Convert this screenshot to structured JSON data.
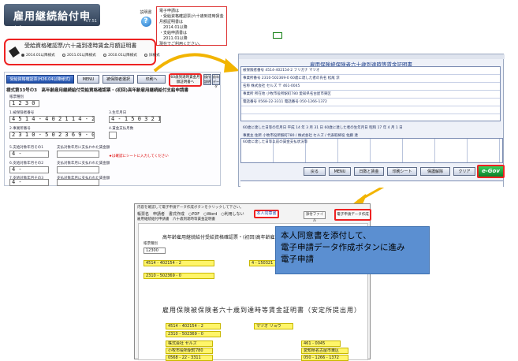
{
  "app": {
    "title": "雇用継続給付申請",
    "version": "V7.51"
  },
  "help": {
    "label": "説明書",
    "icon": "question-icon"
  },
  "note": {
    "lines": [
      "電子申請は",
      "・受給資格確認票/六十歳到達時賃金月額証明書は",
      "　2014.01以降",
      "・支給申請書は",
      "　2011.01以降",
      "現在でご利用ください。"
    ]
  },
  "selector": {
    "title": "受給資格確認票/六十歳到達時賃金月額証明書",
    "options": [
      {
        "label": "2014.01以降様式",
        "selected": true
      },
      {
        "label": "2011.01以降様式",
        "selected": false
      },
      {
        "label": "2010.01以降様式",
        "selected": false
      },
      {
        "label": "旧様式",
        "selected": false
      }
    ]
  },
  "left_form": {
    "toolbar": {
      "primary": "受給資格確認票(H26.04以降様式)",
      "menu": "MENU",
      "other": "被保険者選択",
      "print": "印刷へ",
      "hilite": "60歳到達時賃金月額証明書へ",
      "b1": "操作説明",
      "b2": "前年データ",
      "b3": "前年データ"
    },
    "heading": "様式第33号の3　高年齢雇用継続給付受給資格確認票・(初回)高年齢雇用継続給付支給申請書",
    "fields": {
      "code_label": "帳票種別",
      "code_value": "1 2 3 0 0",
      "insured_no_label": "1.被保険者番号",
      "insured_no": "4 5 1 4 - 4 0 2 1 1 4 - 2",
      "office_no_label": "2.事業所番号",
      "office_no": "2 3 1 0 - 5 0 2 3 6 9 - 0",
      "birth_label": "3.生年月日",
      "birth_value": "4 - 1 5 0 3 2 1",
      "month_label": "4.賃金支払月数",
      "f5": "5.支給対象年月その1",
      "f6": "6.支給対象年月その2",
      "f7": "7.支給対象年月その3",
      "pay1": "支払対象年月に支払われた賃金額",
      "pay2": "支払対象年月に支払われた賃金額",
      "pay3": "支払対象年月に支払われた賃金額",
      "red_note": "★は確認にシートに入力してください",
      "prefix1": "4 -",
      "prefix2": "4 -",
      "prefix3": "4 -"
    }
  },
  "right_form": {
    "title": "雇用保険被保険者六十歳到達時等賃金証明書",
    "row1": "被保険者番号 4514-402154-2   フリガナ マツオ",
    "row2": "事業所番号 2310-502369-0   60歳に達した者の氏名 松尾 涼",
    "row3": "名称 株式会社 セルズ   〒 461-0045",
    "row4": "事業所 所在地 小牧市役所駅町780   愛知県名古屋市東区",
    "row5": "電話番号 0568-22-3311   電話番号 050-1266-1372",
    "row6": "60歳に達した日等の年月日 平成 14 年 3 月 31 日   60歳に達した者の生年月日 昭和 17 年 4 月 1 日",
    "row7": "事業主 住所 小牧市役所駅町780 / 株式会社 セルズ / 代表取締役 佐藤 達",
    "buttons": {
      "back": "戻る",
      "menu": "MENU",
      "auto": "日数と賃金",
      "print": "印刷シート",
      "save": "保護解除",
      "clear": "クリア",
      "egov": "e-Gov"
    },
    "table_caption": "60歳に達した日等以前の賃金支払状況等"
  },
  "dialog": {
    "title": "内容を確認して電子申請データ作成ボタンをクリックして下さい。",
    "columns": "帳票名　申請者　書式作成　○PDF　○Word　○利用しない",
    "format_link": "本人同意書",
    "attach": "添付ファイル",
    "egov_data": "電子申請データ作成",
    "tabs": "雇用継続給付申請書　六十歳到達時等賃金証明書",
    "paper_head": "高年齢雇用継続給付受給資格確認票・(初回)高年齢雇用継続給付支給申請書",
    "form_code": "12300",
    "insured": "4514 - 402154 - 2",
    "office": "2310 - 502369 - 0",
    "birth": "4 - 150321",
    "paper_head2": "雇用保険被保険者六十歳到達時等賃金証明書（安定所提出用）",
    "insured2": "4514 - 402154 - 2",
    "furigana": "マツオ リョウ",
    "office2": "2310 - 502369 - 0",
    "company": "株式会社 セルズ",
    "address": "小牧市役所駅町780",
    "phone": "0568 - 22 - 3311",
    "zip": "461 - 0045",
    "address2": "愛知県名古屋市東区",
    "phone2": "050 - 1266 - 1372"
  },
  "callout": {
    "lines": [
      "本人同意書を添付して、",
      "電子申請データ作成ボタンに進み",
      "電子申請"
    ]
  },
  "colors": {
    "accent_red": "#ee2222",
    "callout_bg": "#5b8fd1",
    "arrow": "#f2b400",
    "egov_green": "#1a9a3b"
  }
}
